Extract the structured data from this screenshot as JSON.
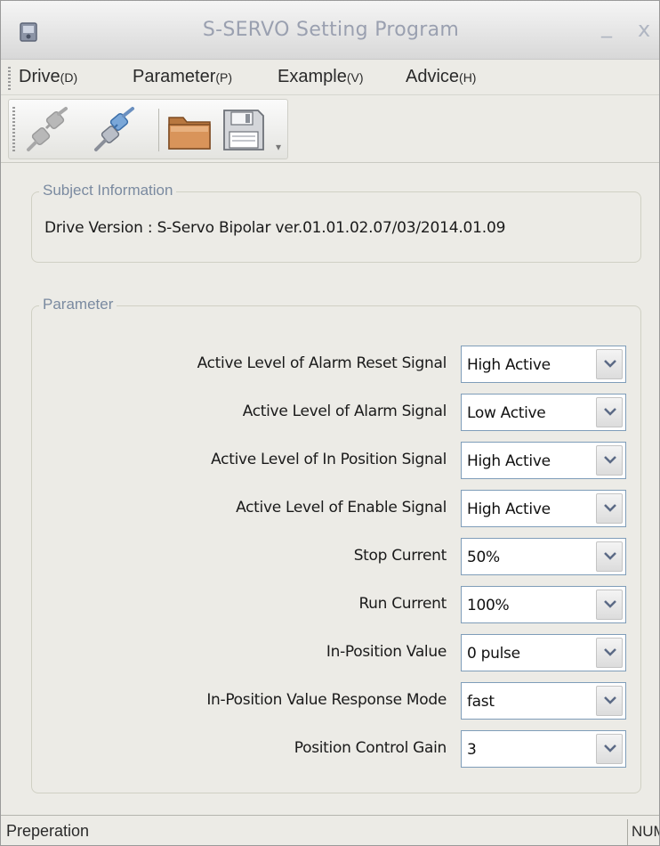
{
  "window": {
    "title": "S-SERVO Setting Program",
    "minimize_glyph": "_",
    "close_glyph": "x"
  },
  "menu": [
    {
      "label": "Drive",
      "accel": "(D)"
    },
    {
      "label": "Parameter",
      "accel": "(P)"
    },
    {
      "label": "Example",
      "accel": "(V)"
    },
    {
      "label": "Advice",
      "accel": "(H)"
    }
  ],
  "toolbar": {
    "buttons": [
      {
        "icon": "disconnect-icon"
      },
      {
        "icon": "connect-icon"
      },
      {
        "icon": "open-folder-icon"
      },
      {
        "icon": "save-icon"
      }
    ]
  },
  "subject": {
    "legend": "Subject Information",
    "drive_version": "Drive Version : S-Servo Bipolar ver.01.01.02.07/03/2014.01.09"
  },
  "parameter": {
    "legend": "Parameter",
    "rows": [
      {
        "label": "Active Level of Alarm Reset Signal",
        "value": "High Active"
      },
      {
        "label": "Active Level of Alarm Signal",
        "value": "Low Active"
      },
      {
        "label": "Active Level of In Position Signal",
        "value": "High Active"
      },
      {
        "label": "Active Level of Enable Signal",
        "value": "High Active"
      },
      {
        "label": "Stop Current",
        "value": "50%"
      },
      {
        "label": "Run Current",
        "value": "100%"
      },
      {
        "label": "In-Position Value",
        "value": "0 pulse"
      },
      {
        "label": "In-Position Value Response Mode",
        "value": "fast"
      },
      {
        "label": "Position Control Gain",
        "value": "3"
      }
    ]
  },
  "status": {
    "text": "Preperation",
    "num": "NUM"
  },
  "colors": {
    "window_bg": "#ecebe6",
    "legend_text": "#7a8aa0",
    "select_border": "#7f9db9"
  }
}
